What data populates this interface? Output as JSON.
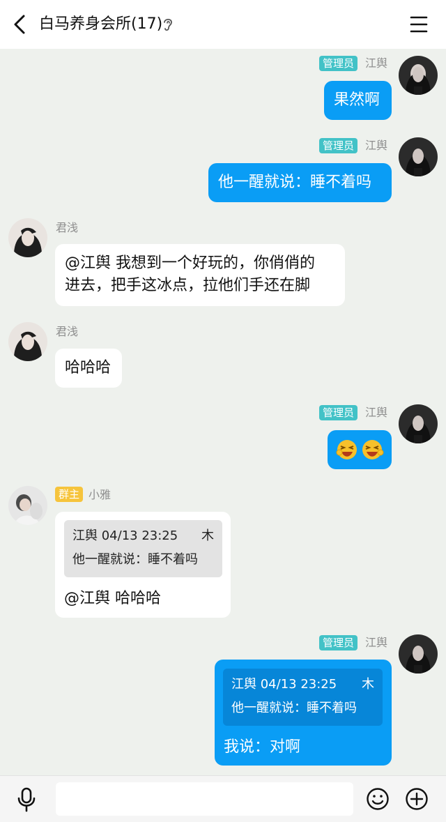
{
  "header": {
    "title": "白马养身会所(17)"
  },
  "messages": [
    {
      "sender": "江舆",
      "badge": "管理员",
      "text": "果然啊"
    },
    {
      "sender": "江舆",
      "badge": "管理员",
      "text": "他一醒就说：睡不着吗"
    },
    {
      "sender": "君浅",
      "line1": "@江舆 我想到一个好玩的，你俏俏的",
      "line2": "进去，把手这冰点，拉他们手还在脚"
    },
    {
      "sender": "君浅",
      "text": "哈哈哈"
    },
    {
      "sender": "江舆",
      "badge": "管理员",
      "emoji": "laughing-face-emoji"
    },
    {
      "sender": "小雅",
      "badge": "群主",
      "quote_meta": "江舆 04/13 23:25",
      "quote_text": "他一醒就说：睡不着吗",
      "reply": "@江舆 哈哈哈"
    },
    {
      "sender": "江舆",
      "badge": "管理员",
      "quote_meta": "江舆 04/13 23:25",
      "quote_text": "他一醒就说：睡不着吗",
      "reply": "我说：对啊"
    }
  ],
  "quote_arrow": "⽊",
  "input": {
    "value": ""
  },
  "colors": {
    "outgoing": "#0a9df5",
    "incoming": "#ffffff",
    "admin_badge": "#42c2c7",
    "owner_badge": "#f6c43c"
  }
}
